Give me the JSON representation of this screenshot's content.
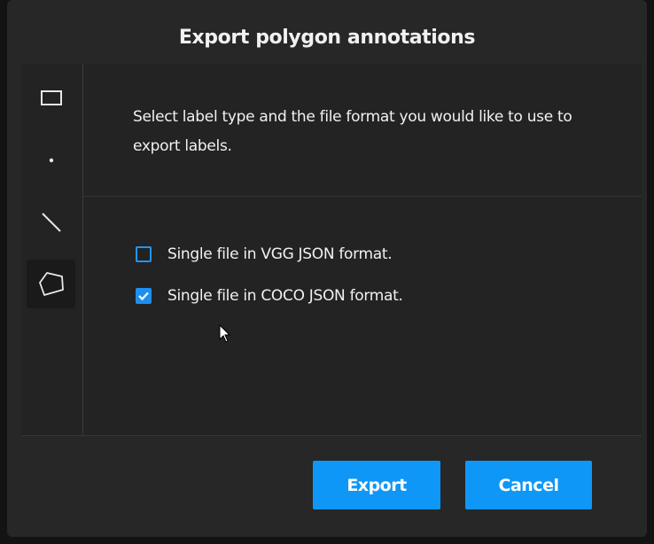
{
  "dialog": {
    "title": "Export polygon annotations",
    "description": "Select label type and the file format you would like to use to export labels."
  },
  "tools": [
    {
      "name": "rectangle-tool",
      "icon": "rectangle-icon",
      "active": false
    },
    {
      "name": "point-tool",
      "icon": "point-icon",
      "active": false
    },
    {
      "name": "line-tool",
      "icon": "line-icon",
      "active": false
    },
    {
      "name": "polygon-tool",
      "icon": "polygon-icon",
      "active": true
    }
  ],
  "options": [
    {
      "label": "Single file in VGG JSON format.",
      "checked": false
    },
    {
      "label": "Single file in COCO JSON format.",
      "checked": true
    }
  ],
  "buttons": {
    "export": "Export",
    "cancel": "Cancel"
  },
  "colors": {
    "accent": "#0f97f7",
    "dialog_bg": "#262726",
    "panel_bg": "#222322",
    "text": "#f1f1f1"
  }
}
